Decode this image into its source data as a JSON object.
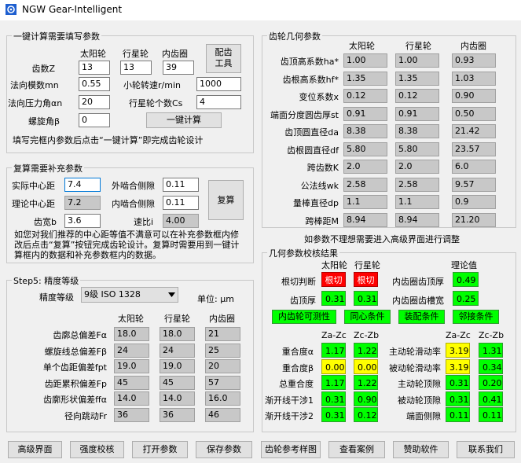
{
  "app": {
    "title": "NGW Gear-Intelligent"
  },
  "calc": {
    "legend": "一键计算需要填写参数",
    "col_sun": "太阳轮",
    "col_planet": "行星轮",
    "col_ring": "内齿圈",
    "teeth_label": "齿数Z",
    "z_sun": "13",
    "z_planet": "13",
    "z_ring": "39",
    "tool_button": "配齿\n工具",
    "module_label": "法向模数mn",
    "module": "0.55",
    "speed_label": "小轮转速r/min",
    "speed": "1000",
    "angle_label": "法向压力角αn",
    "angle": "20",
    "cs_label": "行星轮个数Cs",
    "cs": "4",
    "helix_label": "螺旋角β",
    "helix": "0",
    "calc_button": "一键计算",
    "hint": "填写完框内参数后点击“一键计算”即完成齿轮设计"
  },
  "recheck": {
    "legend": "复算需要补充参数",
    "center_label": "实际中心距",
    "center": "7.4",
    "ext_backlash_label": "外啮合侧隙",
    "ext_backlash": "0.11",
    "theory_label": "理论中心距",
    "theory": "7.2",
    "int_backlash_label": "内啮合侧隙",
    "int_backlash": "0.11",
    "recalc_button": "复算",
    "width_label": "齿宽b",
    "width": "3.6",
    "ratio_label": "速比i",
    "ratio": "4.00",
    "note": "如您对我们推荐的中心距等值不满意可以在补充参数框内修改后点击“复算”按钮完成齿轮设计。复算时需要用到一键计算框内的数据和补充参数框内的数据。"
  },
  "precision": {
    "legend": "Step5: 精度等级",
    "grade_label": "精度等级",
    "grade": "9级 ISO 1328",
    "unit": "单位: μm",
    "col_sun": "太阳轮",
    "col_planet": "行星轮",
    "col_ring": "内齿圈",
    "rows": [
      {
        "label": "齿廓总偏差Fα",
        "v": [
          "18.0",
          "18.0",
          "21"
        ]
      },
      {
        "label": "螺旋线总偏差Fβ",
        "v": [
          "24",
          "24",
          "25"
        ]
      },
      {
        "label": "单个齿距偏差fpt",
        "v": [
          "19.0",
          "19.0",
          "20"
        ]
      },
      {
        "label": "齿距累积偏差Fp",
        "v": [
          "45",
          "45",
          "57"
        ]
      },
      {
        "label": "齿廓形状偏差ffα",
        "v": [
          "14.0",
          "14.0",
          "16.0"
        ]
      },
      {
        "label": "径向跳动Fr",
        "v": [
          "36",
          "36",
          "46"
        ]
      }
    ]
  },
  "geometry": {
    "legend": "齿轮几何参数",
    "col_sun": "太阳轮",
    "col_planet": "行星轮",
    "col_ring": "内齿圈",
    "rows": [
      {
        "label": "齿顶高系数ha*",
        "v": [
          "1.00",
          "1.00",
          "0.93"
        ]
      },
      {
        "label": "齿根高系数hf*",
        "v": [
          "1.35",
          "1.35",
          "1.03"
        ]
      },
      {
        "label": "变位系数x",
        "v": [
          "0.12",
          "0.12",
          "0.90"
        ]
      },
      {
        "label": "端面分度圆齿厚st",
        "v": [
          "0.91",
          "0.91",
          "0.50"
        ]
      },
      {
        "label": "齿顶圆直径da",
        "v": [
          "8.38",
          "8.38",
          "21.42"
        ]
      },
      {
        "label": "齿根圆直径df",
        "v": [
          "5.80",
          "5.80",
          "23.57"
        ]
      },
      {
        "label": "跨齿数K",
        "v": [
          "2.0",
          "2.0",
          "6.0"
        ]
      },
      {
        "label": "公法线wk",
        "v": [
          "2.58",
          "2.58",
          "9.57"
        ]
      },
      {
        "label": "量棒直径dp",
        "v": [
          "1.1",
          "1.1",
          "0.9"
        ]
      },
      {
        "label": "跨棒距M",
        "v": [
          "8.94",
          "8.94",
          "21.20"
        ]
      }
    ],
    "advanced_hint": "如参数不理想需要进入高级界面进行调整"
  },
  "check": {
    "legend": "几何参数校核结果",
    "col_sun": "太阳轮",
    "col_planet": "行星轮",
    "col_theory": "理论值",
    "undercut_label": "根切判断",
    "undercut_sun": "根切",
    "undercut_planet": "根切",
    "ring_tip_label": "内齿圈齿顶厚",
    "ring_tip": "0.49",
    "tip_label": "齿顶厚",
    "tip_sun": "0.31",
    "tip_planet": "0.31",
    "ring_slot_label": "内齿圈齿槽宽",
    "ring_slot": "0.25",
    "buttons": [
      "内齿轮可测性",
      "同心条件",
      "装配条件",
      "邻接条件"
    ],
    "zac": "Za-Zc",
    "zcb": "Zc-Zb",
    "rows_left": [
      {
        "label": "重合度α",
        "a": "1.17",
        "b": "1.22",
        "ya": false,
        "yb": false
      },
      {
        "label": "重合度β",
        "a": "0.00",
        "b": "0.00",
        "ya": true,
        "yb": true
      },
      {
        "label": "总重合度",
        "a": "1.17",
        "b": "1.22",
        "ya": false,
        "yb": false
      },
      {
        "label": "渐开线干涉1",
        "a": "0.31",
        "b": "0.90",
        "ya": false,
        "yb": false
      },
      {
        "label": "渐开线干涉2",
        "a": "0.31",
        "b": "0.12",
        "ya": false,
        "yb": false
      }
    ],
    "rows_right": [
      {
        "label": "主动轮滑动率",
        "a": "3.19",
        "b": "1.31",
        "ya": true,
        "yb": false
      },
      {
        "label": "被动轮滑动率",
        "a": "3.19",
        "b": "0.34",
        "ya": true,
        "yb": false
      },
      {
        "label": "主动轮顶隙",
        "a": "0.31",
        "b": "0.20",
        "ya": false,
        "yb": false
      },
      {
        "label": "被动轮顶隙",
        "a": "0.31",
        "b": "0.41",
        "ya": false,
        "yb": false
      },
      {
        "label": "端面侧隙",
        "a": "0.11",
        "b": "0.11",
        "ya": false,
        "yb": false
      }
    ]
  },
  "bottom": {
    "buttons": [
      "高级界面",
      "强度校核",
      "打开参数",
      "保存参数",
      "齿轮参考样图",
      "查看案例",
      "赞助软件",
      "联系我们"
    ]
  }
}
